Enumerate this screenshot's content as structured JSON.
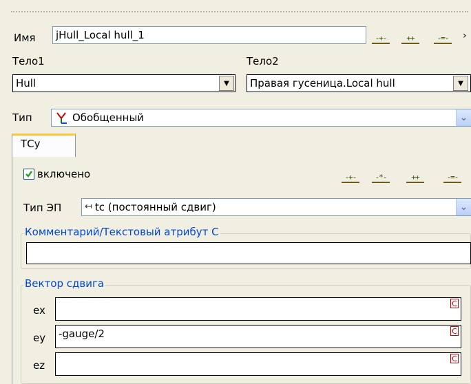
{
  "header": {
    "name_label": "Имя",
    "name_value": "jHull_Local hull_1",
    "body1_label": "Тело1",
    "body1_value": "Hull",
    "body2_label": "Тело2",
    "body2_value": "Правая гусеница.Local hull",
    "type_label": "Тип",
    "type_value": "Обобщенный"
  },
  "tabs": [
    {
      "label": "ТСу"
    }
  ],
  "tcu": {
    "enabled_label": "включено",
    "enabled_checked": true,
    "ep_type_label": "Тип ЭП",
    "ep_type_value": "tc (постоянный сдвиг)",
    "comment_legend": "Комментарий/Текстовый атрибут C",
    "comment_value": "",
    "shift_vector_legend": "Вектор сдвига",
    "ex_label": "ex",
    "ex_value": "",
    "ey_label": "ey",
    "ey_value": "-gauge/2",
    "ez_label": "ez",
    "ez_value": "",
    "c_badge": "C"
  },
  "icons": {
    "dropdown_arrow": "▼",
    "xp_dropdown_arrow": "⌄"
  },
  "colors": {
    "background": "#f1efe2",
    "legend_text": "#0046d5",
    "tab_accent": "#ffc83c",
    "c_badge": "#cc0000"
  }
}
